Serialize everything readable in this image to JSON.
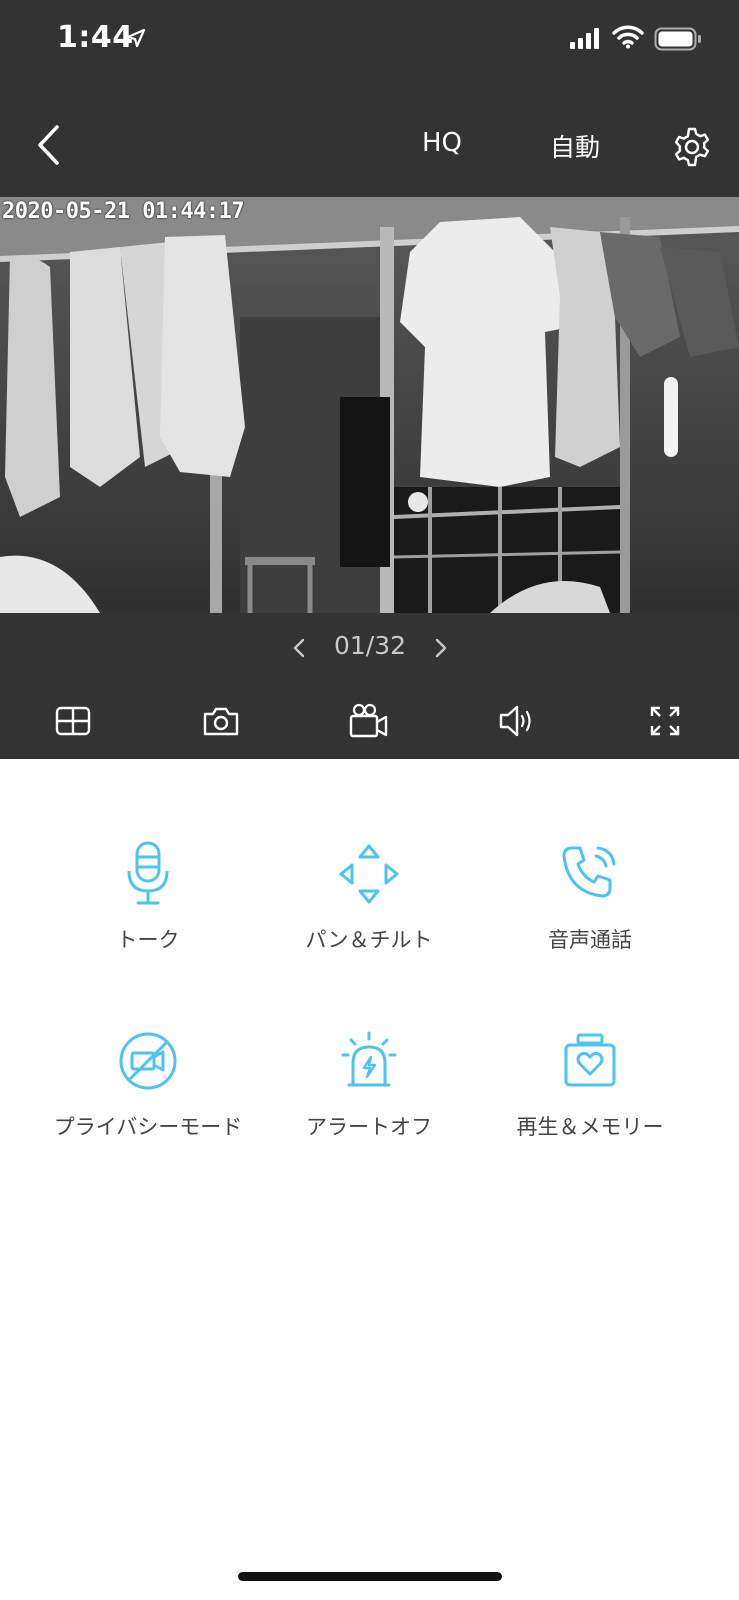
{
  "status_bar": {
    "time": "1:44"
  },
  "nav": {
    "quality": "HQ",
    "mode": "自動"
  },
  "camera": {
    "timestamp": "2020-05-21  01:44:17"
  },
  "pager": {
    "current": "01/32"
  },
  "colors": {
    "dark_bg": "#333333",
    "accent": "#4fc3f0",
    "label": "#444444"
  },
  "features": [
    {
      "label": "トーク",
      "icon": "microphone-icon"
    },
    {
      "label": "パン＆チルト",
      "icon": "pan-tilt-icon"
    },
    {
      "label": "音声通話",
      "icon": "phone-call-icon"
    },
    {
      "label": "プライバシーモード",
      "icon": "privacy-mode-icon"
    },
    {
      "label": "アラートオフ",
      "icon": "alarm-light-icon"
    },
    {
      "label": "再生＆メモリー",
      "icon": "memory-heart-icon"
    }
  ]
}
